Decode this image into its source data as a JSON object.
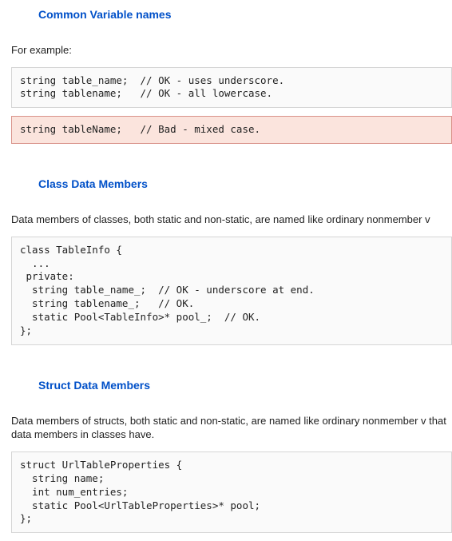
{
  "section1": {
    "heading": "Common Variable names",
    "intro": "For example:",
    "code_ok": "string table_name;  // OK - uses underscore.\nstring tablename;   // OK - all lowercase.",
    "code_bad": "string tableName;   // Bad - mixed case."
  },
  "section2": {
    "heading": "Class Data Members",
    "intro": "Data members of classes, both static and non-static, are named like ordinary nonmember v",
    "code": "class TableInfo {\n  ...\n private:\n  string table_name_;  // OK - underscore at end.\n  string tablename_;   // OK.\n  static Pool<TableInfo>* pool_;  // OK.\n};"
  },
  "section3": {
    "heading": "Struct Data Members",
    "intro": "Data members of structs, both static and non-static, are named like ordinary nonmember v that data members in classes have.",
    "code": "struct UrlTableProperties {\n  string name;\n  int num_entries;\n  static Pool<UrlTableProperties>* pool;\n};"
  }
}
